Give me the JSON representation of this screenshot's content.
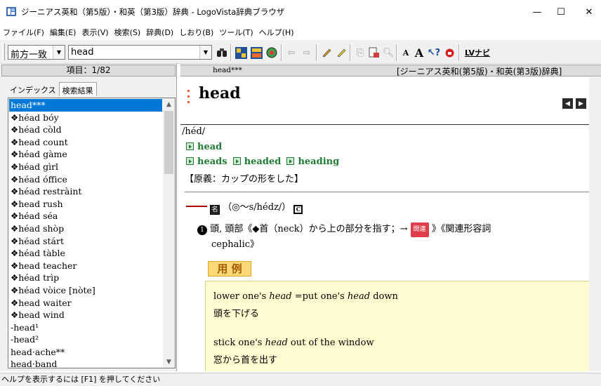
{
  "window": {
    "title": "ジーニアス英和（第5版）・和英（第3版）辞典 - LogoVista辞典ブラウザ",
    "minimize": "—",
    "maximize": "☐",
    "close": "✕"
  },
  "menu": [
    "ファイル(F)",
    "編集(E)",
    "表示(V)",
    "検索(S)",
    "辞典(D)",
    "しおり(B)",
    "ツール(T)",
    "ヘルプ(H)"
  ],
  "toolbar": {
    "search_mode": "前方一致",
    "search_query": "head",
    "lv_nav_label": "LVナビ"
  },
  "left_pane": {
    "header": "項目：1/82",
    "tabs": [
      "インデックス",
      "検索結果"
    ],
    "active_tab": "検索結果",
    "results": [
      "head***",
      "❖héad bóy",
      "❖héad còld",
      "❖head count",
      "❖héad gàme",
      "❖héad gìrl",
      "❖héad óffice",
      "❖héad restràint",
      "❖head rush",
      "❖héad séa",
      "❖héad shòp",
      "❖héad stárt",
      "❖héad tàble",
      "❖head teacher",
      "❖héad trìp",
      "❖héad vòice [nòte]",
      "❖head waiter",
      "❖head wind",
      "-head¹",
      "-head²",
      "head·ache**",
      "head·band"
    ]
  },
  "right_pane": {
    "header_headword": "head***",
    "header_source": "[ジーニアス英和(第5版)・和英(第3版)辞典]",
    "headword": "head",
    "pronunciation": "/héd/",
    "conjugation_1": "head",
    "conjugation_2a": "heads",
    "conjugation_2b": "headed",
    "conjugation_2c": "heading",
    "etymology": "【原義：カップの形をした】",
    "pos_label": "名",
    "pos_detail": "（◎～s/hédz/）",
    "pos_badge": "C",
    "sense_number": "1",
    "sense_text": "頭, 頭部《◆首（neck）から上の部分を指す；→",
    "related_badge": "関連",
    "sense_text_2": "》《関連形容詞",
    "sense_text_3": "cephalic》",
    "examples_label": "用 例",
    "example_1_en_a": "lower one's ",
    "example_1_en_b": "head",
    "example_1_en_c": " =put one's ",
    "example_1_en_d": "head",
    "example_1_en_e": " down",
    "example_1_ja": "頭を下げる",
    "example_2_en_a": "stick one's ",
    "example_2_en_b": "head",
    "example_2_en_c": " out of the window",
    "example_2_ja": "窓から首を出す"
  },
  "status_bar": {
    "text": "ヘルプを表示するには [F1] を押してください"
  },
  "colors": {
    "selection": "#0078d7",
    "green_link": "#1e7b32",
    "example_bg": "#fffbd0",
    "yorei_bg": "#fbd778"
  }
}
